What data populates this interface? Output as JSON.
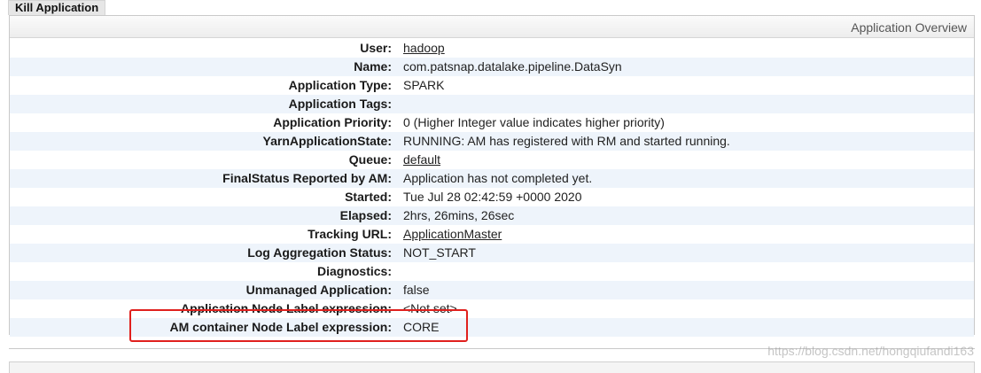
{
  "kill_button_label": "Kill Application",
  "panel_title": "Application Overview",
  "rows": [
    {
      "label": "User:",
      "value": "hadoop",
      "link": true
    },
    {
      "label": "Name:",
      "value": "com.patsnap.datalake.pipeline.DataSyn",
      "link": false
    },
    {
      "label": "Application Type:",
      "value": "SPARK",
      "link": false
    },
    {
      "label": "Application Tags:",
      "value": "",
      "link": false
    },
    {
      "label": "Application Priority:",
      "value": "0 (Higher Integer value indicates higher priority)",
      "link": false
    },
    {
      "label": "YarnApplicationState:",
      "value": "RUNNING: AM has registered with RM and started running.",
      "link": false
    },
    {
      "label": "Queue:",
      "value": "default",
      "link": true
    },
    {
      "label": "FinalStatus Reported by AM:",
      "value": "Application has not completed yet.",
      "link": false
    },
    {
      "label": "Started:",
      "value": "Tue Jul 28 02:42:59 +0000 2020",
      "link": false
    },
    {
      "label": "Elapsed:",
      "value": "2hrs, 26mins, 26sec",
      "link": false
    },
    {
      "label": "Tracking URL:",
      "value": "ApplicationMaster",
      "link": true
    },
    {
      "label": "Log Aggregation Status:",
      "value": "NOT_START",
      "link": false
    },
    {
      "label": "Diagnostics:",
      "value": "",
      "link": false
    },
    {
      "label": "Unmanaged Application:",
      "value": "false",
      "link": false
    },
    {
      "label": "Application Node Label expression:",
      "value": "<Not set>",
      "link": false
    },
    {
      "label": "AM container Node Label expression:",
      "value": "CORE",
      "link": false
    }
  ],
  "watermark": "https://blog.csdn.net/hongqiufandi163",
  "highlight_color": "#e0201d"
}
